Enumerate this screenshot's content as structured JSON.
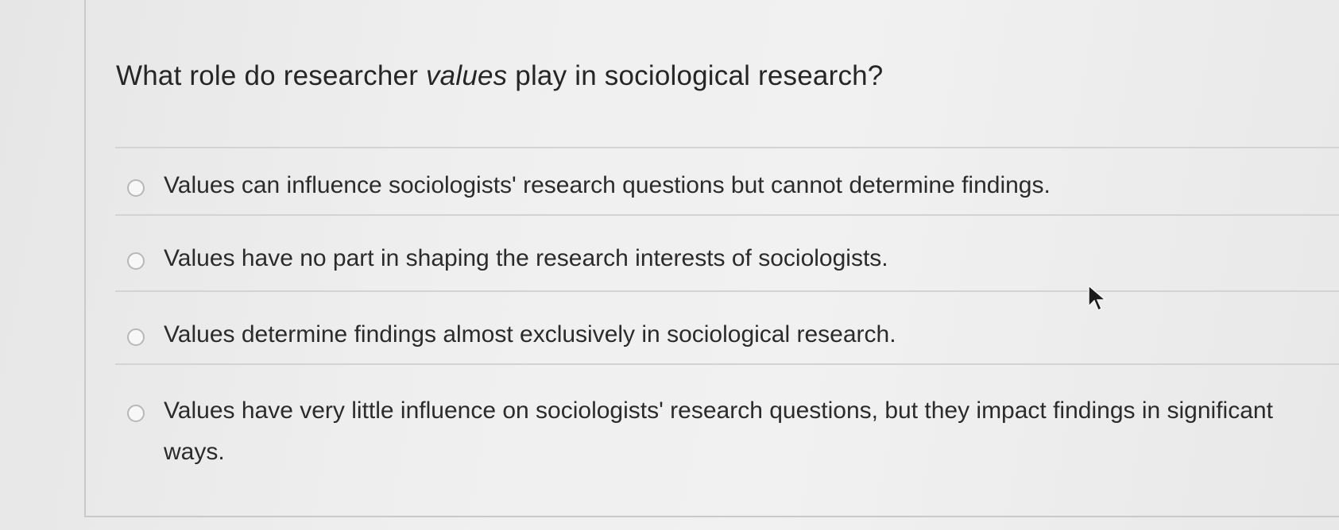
{
  "question": {
    "prefix": "What role do researcher ",
    "emphasis": "values",
    "suffix": " play in sociological research?"
  },
  "options": [
    {
      "label": "Values can influence sociologists' research questions but cannot determine findings.",
      "selected": false
    },
    {
      "label": "Values have no part in shaping the research interests of sociologists.",
      "selected": false
    },
    {
      "label": "Values determine findings almost exclusively in sociological research.",
      "selected": false
    },
    {
      "label": "Values have very little influence on sociologists' research questions, but they impact findings in significant ways.",
      "selected": false
    }
  ],
  "icons": {
    "radio": "radio-unchecked-icon",
    "cursor": "mouse-pointer-icon"
  },
  "colors": {
    "text": "#2a2a2a",
    "divider": "#d3d3d3",
    "radio_border": "#b8b8b8",
    "background": "#ececec"
  }
}
